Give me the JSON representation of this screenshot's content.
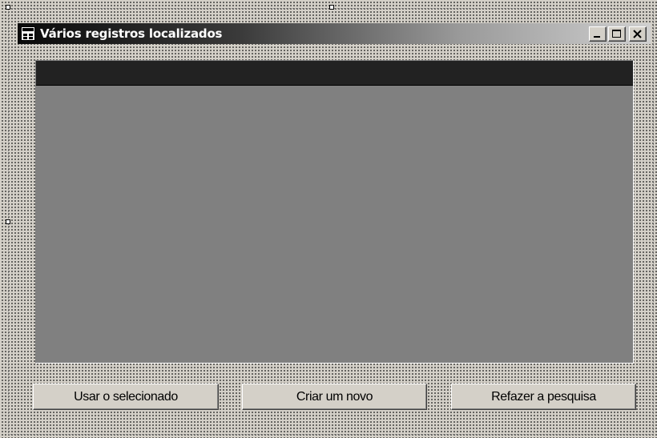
{
  "window": {
    "title": "Vários registros localizados",
    "caption_buttons": {
      "minimize": "minimize-icon",
      "maximize": "maximize-icon",
      "close": "close-icon"
    }
  },
  "grid": {
    "header_color": "#222222",
    "body_color": "#808080"
  },
  "buttons": {
    "use_selected": "Usar o selecionado",
    "create_new": "Criar um novo",
    "redo_search": "Refazer a pesquisa"
  },
  "colors": {
    "face": "#d4d0c8",
    "title_start": "#0a0a0a",
    "title_end": "#cfcfcf"
  }
}
